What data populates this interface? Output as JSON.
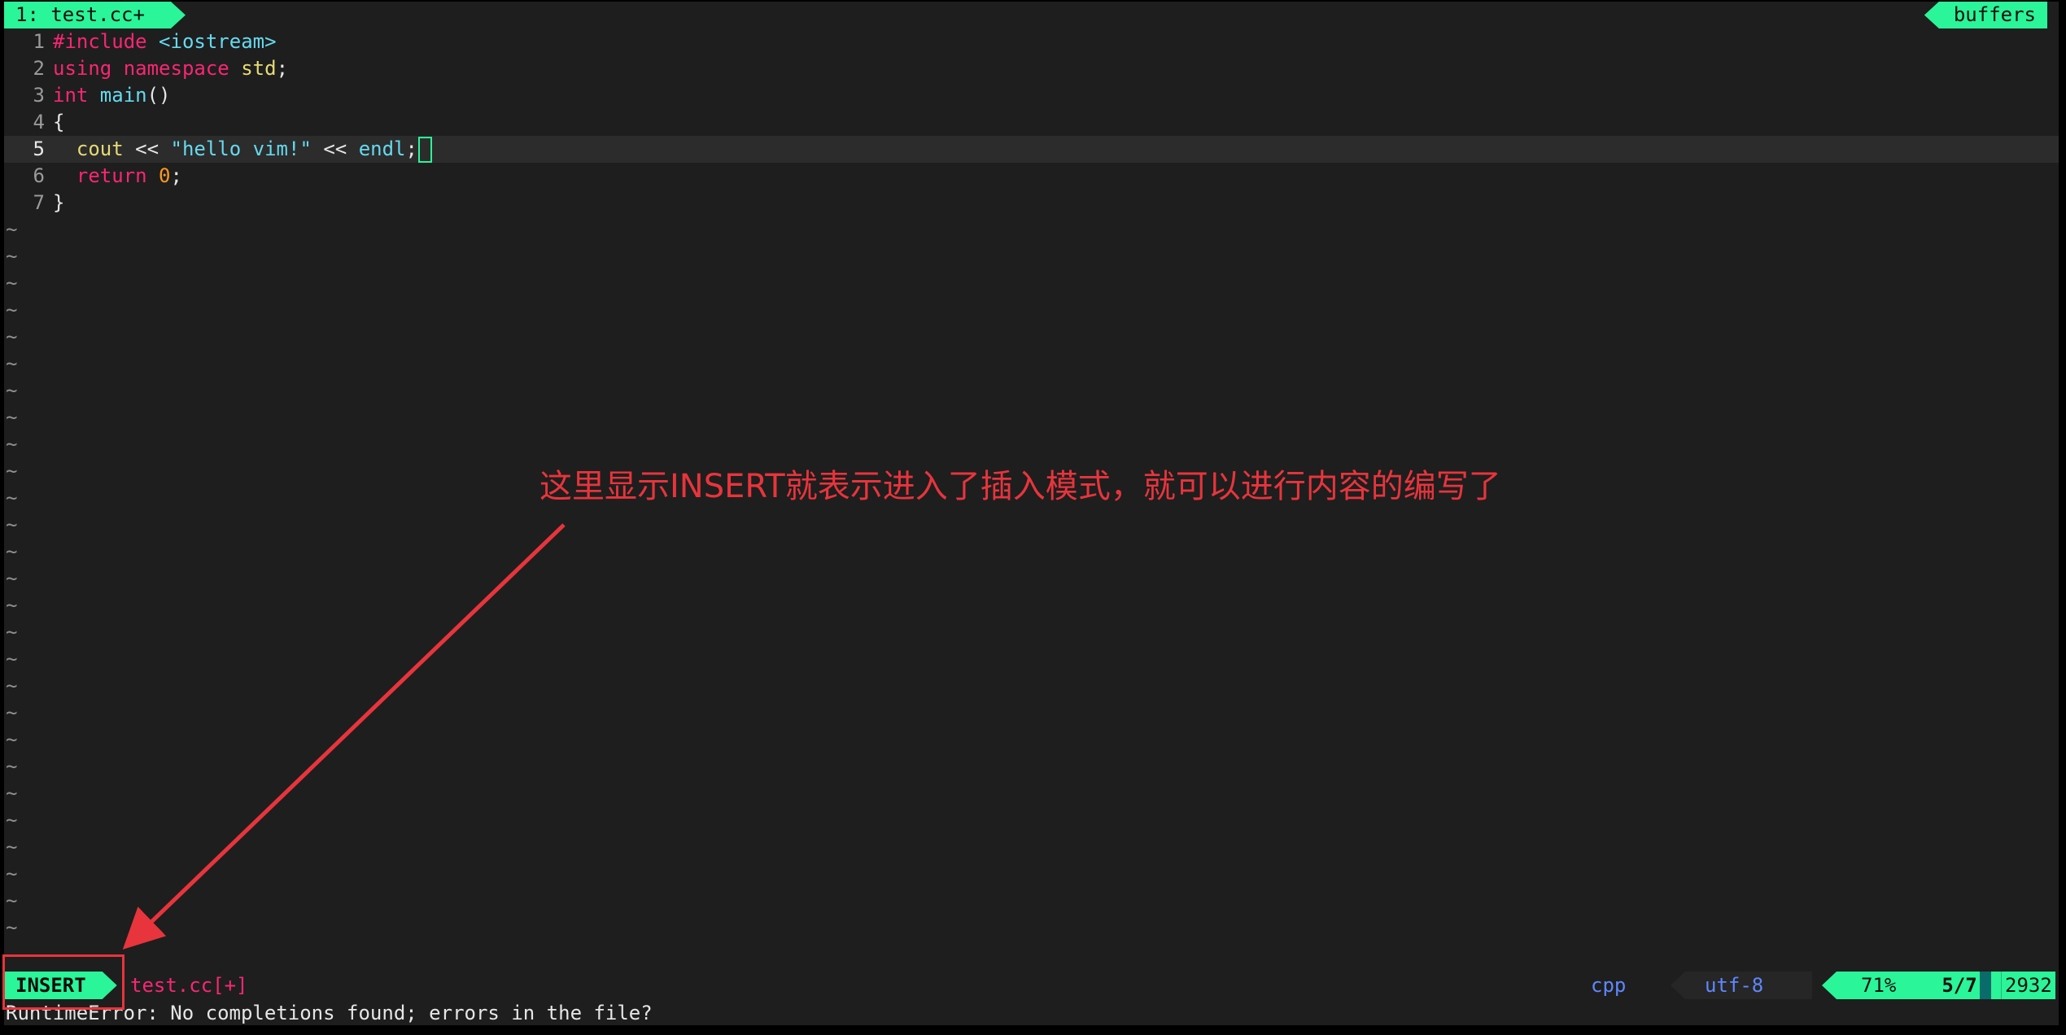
{
  "tabline": {
    "active_tab": "1: test.cc+",
    "right_label": "buffers"
  },
  "editor": {
    "lines": [
      {
        "num": "1",
        "parts": [
          {
            "t": "#include ",
            "c": "kw"
          },
          {
            "t": "<iostream>",
            "c": "inc"
          }
        ]
      },
      {
        "num": "2",
        "parts": [
          {
            "t": "using ",
            "c": "kw"
          },
          {
            "t": "namespace ",
            "c": "kw"
          },
          {
            "t": "std",
            "c": "ident"
          },
          {
            "t": ";",
            "c": ""
          }
        ]
      },
      {
        "num": "3",
        "parts": [
          {
            "t": "int ",
            "c": "type"
          },
          {
            "t": "main",
            "c": "fn"
          },
          {
            "t": "()",
            "c": ""
          }
        ]
      },
      {
        "num": "4",
        "parts": [
          {
            "t": "{",
            "c": ""
          }
        ]
      },
      {
        "num": "5",
        "current": true,
        "parts": [
          {
            "t": "  cout",
            "c": "ident"
          },
          {
            "t": " << ",
            "c": ""
          },
          {
            "t": "\"hello vim!\"",
            "c": "inc"
          },
          {
            "t": " << ",
            "c": ""
          },
          {
            "t": "endl",
            "c": "fn"
          },
          {
            "t": ";",
            "c": ""
          }
        ]
      },
      {
        "num": "6",
        "parts": [
          {
            "t": "  return ",
            "c": "kw"
          },
          {
            "t": "0",
            "c": "num"
          },
          {
            "t": ";",
            "c": ""
          }
        ]
      },
      {
        "num": "7",
        "parts": [
          {
            "t": "}",
            "c": ""
          }
        ]
      }
    ],
    "tilde": "~",
    "tilde_count": 27
  },
  "statusline": {
    "mode": "INSERT",
    "filename": "test.cc[+]",
    "filetype": "cpp",
    "encoding": "utf-8",
    "percent": "71%",
    "position": "5/7",
    "count": "2932"
  },
  "cmdline": "RuntimeError: No completions found; errors in the file?",
  "annotation": {
    "text": "这里显示INSERT就表示进入了插入模式，就可以进行内容的编写了",
    "color": "#e8343c"
  },
  "colors": {
    "accent": "#2af598",
    "background": "#1e1e1e",
    "keyword": "#f92672",
    "annotation": "#e8343c"
  }
}
